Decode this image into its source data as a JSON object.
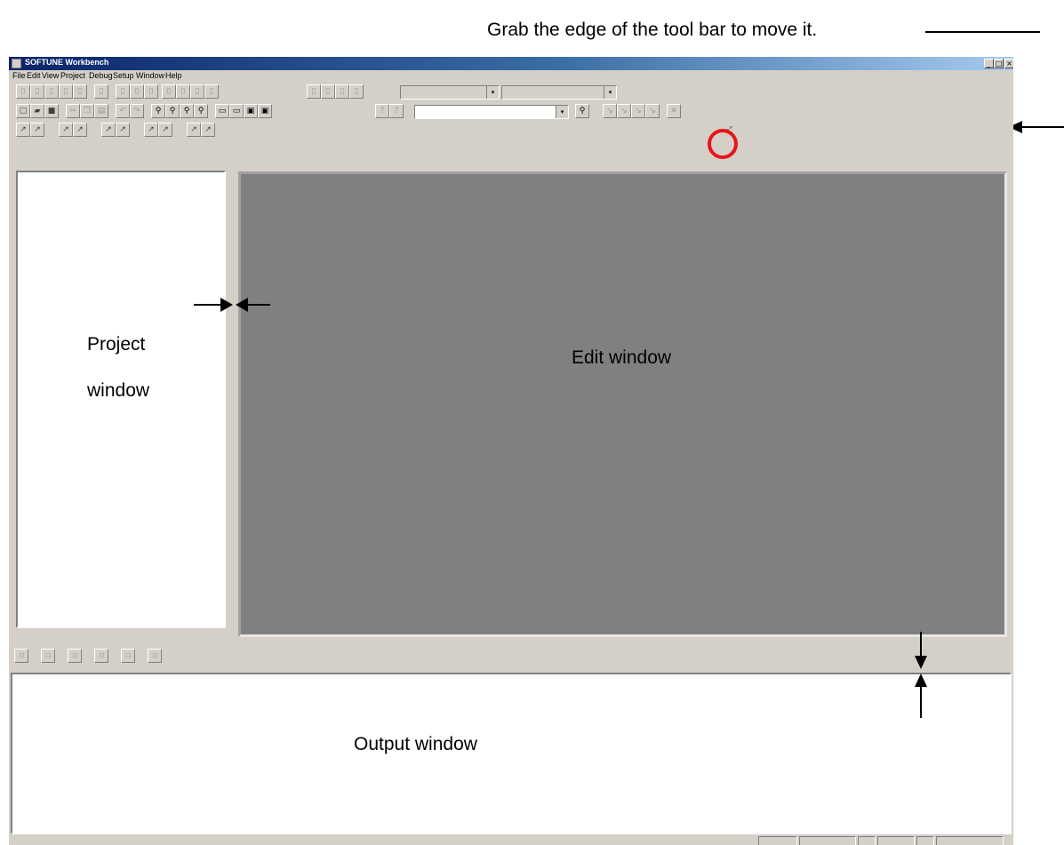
{
  "annotations": {
    "toolbar_hint": "Grab the edge of the tool bar to move it."
  },
  "window": {
    "title": "SOFTUNE Workbench",
    "caption_buttons": [
      "_",
      "□",
      "×"
    ]
  },
  "menu": [
    "File",
    "Edit",
    "View",
    "Project",
    "Debug",
    "Setup",
    "Window",
    "Help"
  ],
  "toolbar_icons": {
    "row1": [
      "debug-icon",
      "debug-icon",
      "debug-icon",
      "debug-icon",
      "debug-icon",
      "debug-icon",
      "debug-icon",
      "debug-icon",
      "debug-icon",
      "debug-icon",
      "debug-icon",
      "debug-icon",
      "debug-icon",
      "debug-icon",
      "debug-icon",
      "debug-icon",
      "debug-icon"
    ],
    "row2": [
      "new-file-icon",
      "open-folder-icon",
      "save-icon",
      "cut-icon",
      "copy-icon",
      "paste-icon",
      "undo-icon",
      "redo-icon",
      "find-icon",
      "find-next-icon",
      "find-prev-icon",
      "replace-icon",
      "window-icon",
      "window-icon",
      "window-icon",
      "window-icon",
      "help-icon",
      "help-icon",
      "find-in-files-icon",
      "jump-icon",
      "jump-icon",
      "jump-icon",
      "jump-icon",
      "close-icon"
    ],
    "row3": [
      "arrow-icon",
      "arrow-icon",
      "arrow-icon",
      "arrow-icon",
      "arrow-icon",
      "arrow-icon",
      "arrow-icon",
      "arrow-icon",
      "arrow-icon",
      "arrow-icon"
    ]
  },
  "panes": {
    "project_line1": "Project",
    "project_line2": "window",
    "edit": "Edit window",
    "output": "Output window"
  },
  "colors": {
    "face": "#d4d0c8",
    "edit_background": "#808080",
    "highlight_circle": "#e8141c"
  }
}
